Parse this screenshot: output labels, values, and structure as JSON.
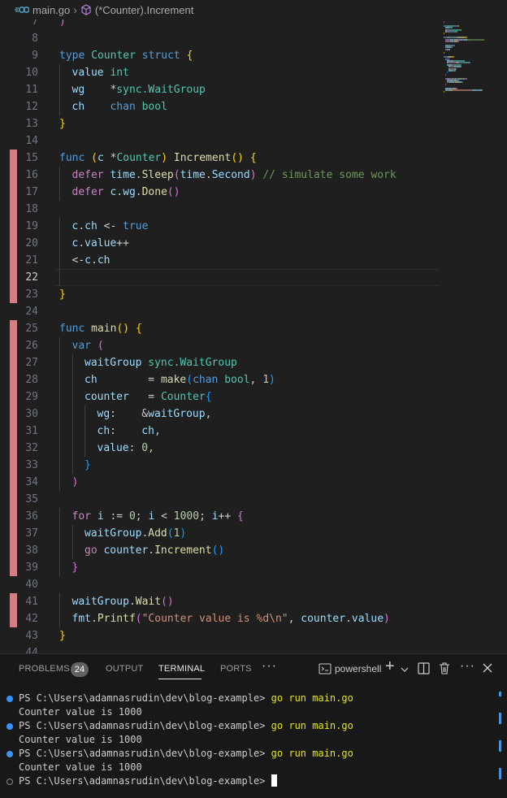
{
  "breadcrumb": {
    "file_icon": "go-file-icon",
    "file": "main.go",
    "separator": "›",
    "symbol_icon": "method-cube-icon",
    "symbol": "(*Counter).Increment"
  },
  "editor": {
    "active_line": 22,
    "lines": [
      {
        "n": "7",
        "tokens": [
          [
            "br2",
            ")"
          ]
        ]
      },
      {
        "n": "8",
        "tokens": []
      },
      {
        "n": "9",
        "tokens": [
          [
            "kw",
            "type"
          ],
          [
            "",
            " "
          ],
          [
            "ty",
            "Counter"
          ],
          [
            "",
            " "
          ],
          [
            "kw",
            "struct"
          ],
          [
            "",
            " "
          ],
          [
            "br1",
            "{"
          ]
        ]
      },
      {
        "n": "10",
        "tokens": [
          [
            "var",
            "value"
          ],
          [
            "",
            " "
          ],
          [
            "ty",
            "int"
          ]
        ]
      },
      {
        "n": "11",
        "tokens": [
          [
            "var",
            "wg"
          ],
          [
            "",
            "    *"
          ],
          [
            "ty",
            "sync.WaitGroup"
          ]
        ]
      },
      {
        "n": "12",
        "tokens": [
          [
            "var",
            "ch"
          ],
          [
            "",
            "    "
          ],
          [
            "kw",
            "chan"
          ],
          [
            "",
            " "
          ],
          [
            "ty",
            "bool"
          ]
        ]
      },
      {
        "n": "13",
        "tokens": [
          [
            "br1",
            "}"
          ]
        ]
      },
      {
        "n": "14",
        "tokens": []
      },
      {
        "n": "15",
        "tokens": [
          [
            "kw",
            "func"
          ],
          [
            "",
            " "
          ],
          [
            "br1",
            "("
          ],
          [
            "var",
            "c"
          ],
          [
            "",
            " *"
          ],
          [
            "ty",
            "Counter"
          ],
          [
            "br1",
            ")"
          ],
          [
            "",
            " "
          ],
          [
            "fn",
            "Increment"
          ],
          [
            "br1",
            "()"
          ],
          [
            "",
            " "
          ],
          [
            "br1",
            "{"
          ]
        ]
      },
      {
        "n": "16",
        "tokens": [
          [
            "kw2",
            "defer"
          ],
          [
            "",
            " "
          ],
          [
            "var",
            "time"
          ],
          [
            "",
            "."
          ],
          [
            "fn",
            "Sleep"
          ],
          [
            "br2",
            "("
          ],
          [
            "var",
            "time"
          ],
          [
            "",
            "."
          ],
          [
            "var",
            "Second"
          ],
          [
            "br2",
            ")"
          ],
          [
            "",
            " "
          ],
          [
            "cmt",
            "// simulate some work"
          ]
        ]
      },
      {
        "n": "17",
        "tokens": [
          [
            "kw2",
            "defer"
          ],
          [
            "",
            " "
          ],
          [
            "var",
            "c"
          ],
          [
            "",
            "."
          ],
          [
            "var",
            "wg"
          ],
          [
            "",
            "."
          ],
          [
            "fn",
            "Done"
          ],
          [
            "br2",
            "()"
          ]
        ]
      },
      {
        "n": "18",
        "tokens": []
      },
      {
        "n": "19",
        "tokens": [
          [
            "var",
            "c"
          ],
          [
            "",
            "."
          ],
          [
            "var",
            "ch"
          ],
          [
            "",
            " <- "
          ],
          [
            "kw",
            "true"
          ]
        ]
      },
      {
        "n": "20",
        "tokens": [
          [
            "var",
            "c"
          ],
          [
            "",
            "."
          ],
          [
            "var",
            "value"
          ],
          [
            "",
            "++"
          ]
        ]
      },
      {
        "n": "21",
        "tokens": [
          [
            "",
            "<-"
          ],
          [
            "var",
            "c"
          ],
          [
            "",
            "."
          ],
          [
            "var",
            "ch"
          ]
        ]
      },
      {
        "n": "22",
        "tokens": []
      },
      {
        "n": "23",
        "tokens": [
          [
            "br1",
            "}"
          ]
        ]
      },
      {
        "n": "24",
        "tokens": []
      },
      {
        "n": "25",
        "tokens": [
          [
            "kw",
            "func"
          ],
          [
            "",
            " "
          ],
          [
            "fn",
            "main"
          ],
          [
            "br1",
            "()"
          ],
          [
            "",
            " "
          ],
          [
            "br1",
            "{"
          ]
        ]
      },
      {
        "n": "26",
        "tokens": [
          [
            "kw",
            "var"
          ],
          [
            "",
            " "
          ],
          [
            "br2",
            "("
          ]
        ]
      },
      {
        "n": "27",
        "tokens": [
          [
            "var",
            "waitGroup"
          ],
          [
            "",
            " "
          ],
          [
            "ty",
            "sync.WaitGroup"
          ]
        ]
      },
      {
        "n": "28",
        "tokens": [
          [
            "var",
            "ch"
          ],
          [
            "",
            "        = "
          ],
          [
            "fn",
            "make"
          ],
          [
            "br3",
            "("
          ],
          [
            "kw",
            "chan"
          ],
          [
            "",
            " "
          ],
          [
            "ty",
            "bool"
          ],
          [
            "",
            ", "
          ],
          [
            "num",
            "1"
          ],
          [
            "br3",
            ")"
          ]
        ]
      },
      {
        "n": "29",
        "tokens": [
          [
            "var",
            "counter"
          ],
          [
            "",
            "   = "
          ],
          [
            "ty",
            "Counter"
          ],
          [
            "br3",
            "{"
          ]
        ]
      },
      {
        "n": "30",
        "tokens": [
          [
            "var",
            "wg"
          ],
          [
            "",
            ":    &"
          ],
          [
            "var",
            "waitGroup"
          ],
          [
            "",
            ","
          ]
        ]
      },
      {
        "n": "31",
        "tokens": [
          [
            "var",
            "ch"
          ],
          [
            "",
            ":    "
          ],
          [
            "var",
            "ch"
          ],
          [
            "",
            ","
          ]
        ]
      },
      {
        "n": "32",
        "tokens": [
          [
            "var",
            "value"
          ],
          [
            "",
            ": "
          ],
          [
            "num",
            "0"
          ],
          [
            "",
            ","
          ]
        ]
      },
      {
        "n": "33",
        "tokens": [
          [
            "br3",
            "}"
          ]
        ]
      },
      {
        "n": "34",
        "tokens": [
          [
            "br2",
            ")"
          ]
        ]
      },
      {
        "n": "35",
        "tokens": []
      },
      {
        "n": "36",
        "tokens": [
          [
            "kw2",
            "for"
          ],
          [
            "",
            " "
          ],
          [
            "var",
            "i"
          ],
          [
            "",
            " := "
          ],
          [
            "num",
            "0"
          ],
          [
            "",
            "; "
          ],
          [
            "var",
            "i"
          ],
          [
            "",
            " < "
          ],
          [
            "num",
            "1000"
          ],
          [
            "",
            "; "
          ],
          [
            "var",
            "i"
          ],
          [
            "",
            "++ "
          ],
          [
            "br2",
            "{"
          ]
        ]
      },
      {
        "n": "37",
        "tokens": [
          [
            "var",
            "waitGroup"
          ],
          [
            "",
            "."
          ],
          [
            "fn",
            "Add"
          ],
          [
            "br3",
            "("
          ],
          [
            "num",
            "1"
          ],
          [
            "br3",
            ")"
          ]
        ]
      },
      {
        "n": "38",
        "tokens": [
          [
            "kw2",
            "go"
          ],
          [
            "",
            " "
          ],
          [
            "var",
            "counter"
          ],
          [
            "",
            "."
          ],
          [
            "fn",
            "Increment"
          ],
          [
            "br3",
            "()"
          ]
        ]
      },
      {
        "n": "39",
        "tokens": [
          [
            "br2",
            "}"
          ]
        ]
      },
      {
        "n": "40",
        "tokens": []
      },
      {
        "n": "41",
        "tokens": [
          [
            "var",
            "waitGroup"
          ],
          [
            "",
            "."
          ],
          [
            "fn",
            "Wait"
          ],
          [
            "br2",
            "()"
          ]
        ]
      },
      {
        "n": "42",
        "tokens": [
          [
            "var",
            "fmt"
          ],
          [
            "",
            "."
          ],
          [
            "fn",
            "Printf"
          ],
          [
            "br2",
            "("
          ],
          [
            "str",
            "\"Counter value is %d\\n\""
          ],
          [
            "",
            ", "
          ],
          [
            "var",
            "counter"
          ],
          [
            "",
            "."
          ],
          [
            "var",
            "value"
          ],
          [
            "br2",
            ")"
          ]
        ]
      },
      {
        "n": "43",
        "tokens": [
          [
            "br1",
            "}"
          ]
        ]
      },
      {
        "n": "44",
        "tokens": []
      }
    ]
  },
  "panel": {
    "tabs": [
      {
        "label": "PROBLEMS",
        "active": false
      },
      {
        "label": "OUTPUT",
        "active": false
      },
      {
        "label": "TERMINAL",
        "active": true
      },
      {
        "label": "PORTS",
        "active": false
      }
    ],
    "problems_count": "24",
    "more_tabs_icon": "ellipsis-icon",
    "terminal_name": "powershell",
    "actions": [
      "new-terminal-plus-icon",
      "dropdown-chevron-icon",
      "split-terminal-icon",
      "trash-icon",
      "more-actions-icon",
      "close-panel-icon"
    ]
  },
  "terminal": {
    "prompt": "PS C:\\Users\\adamnasrudin\\dev\\blog-example>",
    "command": "go run main.go",
    "output": "Counter value is 1000",
    "colors": {
      "success_dot": "#3794ff",
      "command": "#e5e510"
    }
  }
}
